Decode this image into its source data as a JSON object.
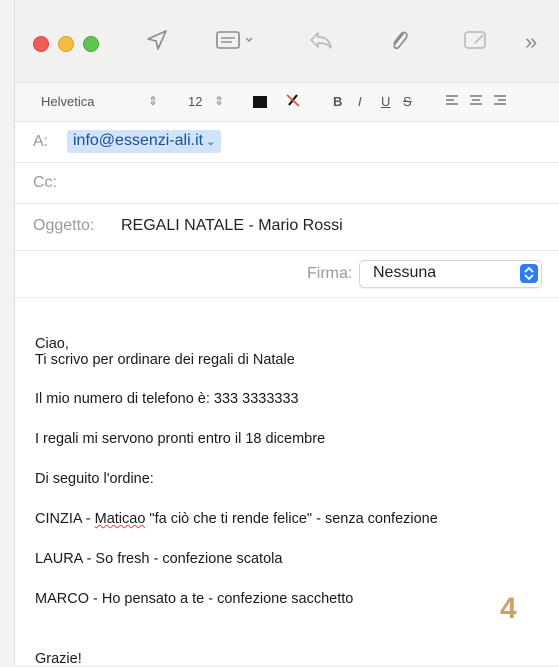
{
  "toolbar": {
    "send_icon": "send-icon",
    "header_fields_icon": "header-fields-icon",
    "reply_icon": "reply-icon",
    "attach_icon": "paperclip-icon",
    "markup_icon": "photo-browser-icon",
    "more_label": "»"
  },
  "format": {
    "font": "Helvetica",
    "size": "12",
    "bold": "B",
    "italic": "I",
    "underline": "U",
    "strike": "S"
  },
  "header": {
    "to_label": "A:",
    "to_value": "info@essenzi-ali.it",
    "cc_label": "Cc:",
    "subject_label": "Oggetto:",
    "subject_value": "REGALI NATALE - Mario Rossi",
    "signature_label": "Firma:",
    "signature_value": "Nessuna"
  },
  "body": {
    "line1": "Ciao,",
    "line2": "Ti scrivo per ordinare dei regali di Natale",
    "line3": "Il mio numero di telefono è: 333 3333333",
    "line4": "I regali mi servono pronti entro il 18 dicembre",
    "line5": "Di seguito l'ordine:",
    "line6_name": "CINZIA - ",
    "line6_misspelled": "Maticao",
    "line6_rest": " \"fa ciò che ti rende felice\" - senza confezione",
    "line7": "LAURA - So fresh - confezione scatola",
    "line8": "MARCO - Ho pensato a te - confezione sacchetto",
    "line9": "Grazie!"
  },
  "page_number": "4",
  "colors": {
    "accent": "#2f7bf5",
    "recipient_bg": "#cfe3fb",
    "page_number": "#c9a46a"
  }
}
